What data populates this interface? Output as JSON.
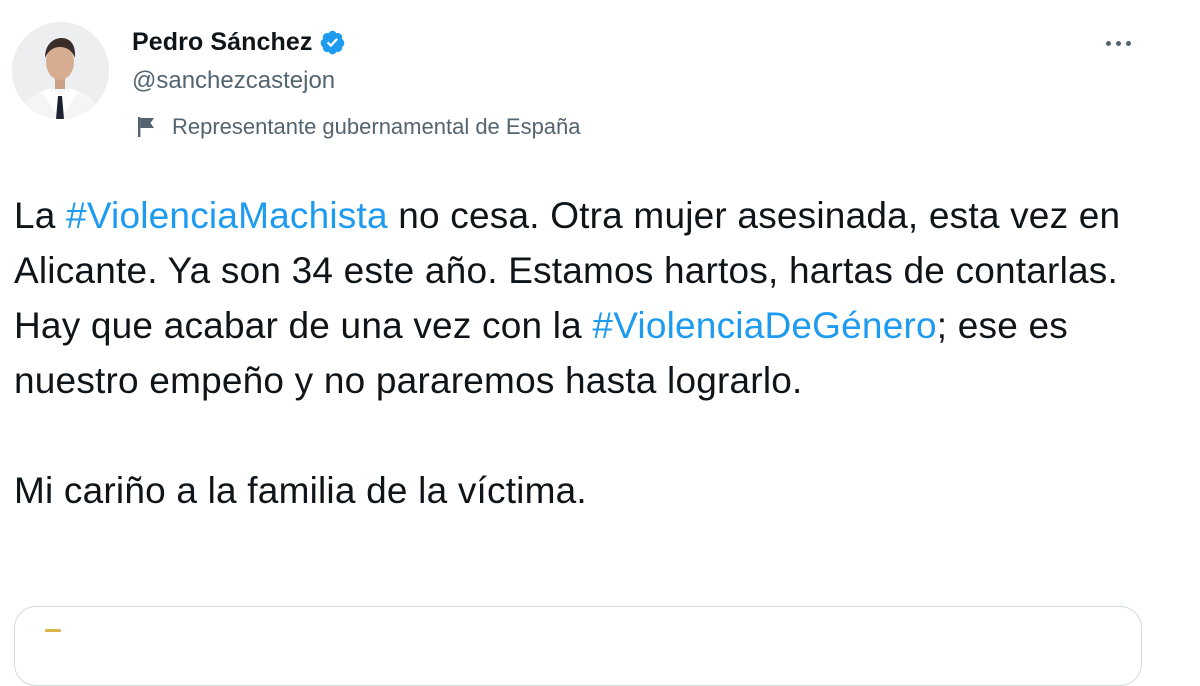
{
  "author": {
    "display_name": "Pedro Sánchez",
    "handle": "@sanchezcastejon",
    "verified": true,
    "label": "Representante gubernamental de España"
  },
  "tweet": {
    "segments_p1": [
      {
        "text": "La ",
        "type": "text"
      },
      {
        "text": "#ViolenciaMachista",
        "type": "hashtag"
      },
      {
        "text": " no cesa. Otra mujer asesinada, esta vez en Alicante. Ya son 34 este año. Estamos hartos, hartas de contarlas. Hay que acabar de una vez con la ",
        "type": "text"
      },
      {
        "text": "#ViolenciaDeGénero",
        "type": "hashtag"
      },
      {
        "text": "; ese es nuestro empeño y no pararemos hasta lograrlo.",
        "type": "text"
      }
    ],
    "paragraph2": "Mi cariño a la familia de la víctima."
  },
  "colors": {
    "text": "#0f1419",
    "secondary": "#536471",
    "link": "#1d9bf0",
    "verified": "#1d9bf0"
  },
  "icons": {
    "verified": "verified-badge-icon",
    "label": "flag-icon",
    "more": "more-options-icon"
  }
}
